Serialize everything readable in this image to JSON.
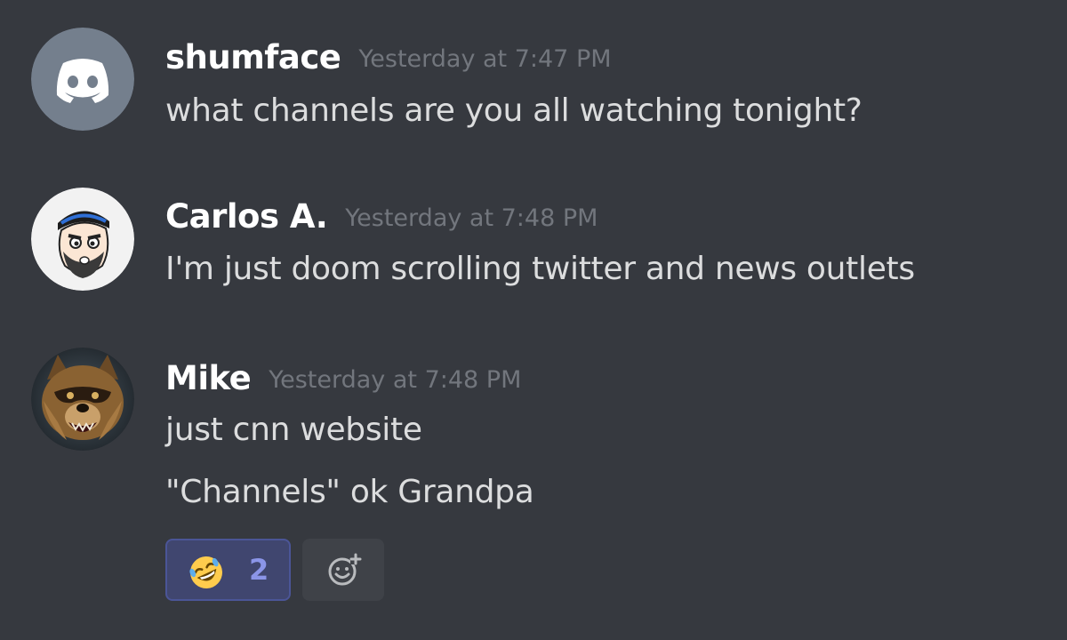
{
  "messages": [
    {
      "username": "shumface",
      "timestamp": "Yesterday at 7:47 PM",
      "avatar": "discord-logo-icon",
      "lines": [
        "what channels are you all watching tonight?"
      ]
    },
    {
      "username": "Carlos A.",
      "timestamp": "Yesterday at 7:48 PM",
      "avatar": "cartoon-man-avatar",
      "lines": [
        "I'm just doom scrolling twitter and news outlets"
      ]
    },
    {
      "username": "Mike",
      "timestamp": "Yesterday at 7:48 PM",
      "avatar": "raccoon-avatar",
      "lines": [
        "just cnn website",
        "\"Channels\" ok Grandpa"
      ]
    }
  ],
  "reactions": [
    {
      "emoji": "rolling-on-floor-laughing-icon",
      "count": "2"
    }
  ],
  "add_reaction_icon": "add-reaction-icon",
  "colors": {
    "background": "#36393f",
    "username": "#ffffff",
    "timestamp": "#72767d",
    "message_text": "#dcddde",
    "reaction_active_bg": "#40466f",
    "reaction_count": "#8b95e8",
    "discord_avatar_bg": "#747f8d"
  }
}
